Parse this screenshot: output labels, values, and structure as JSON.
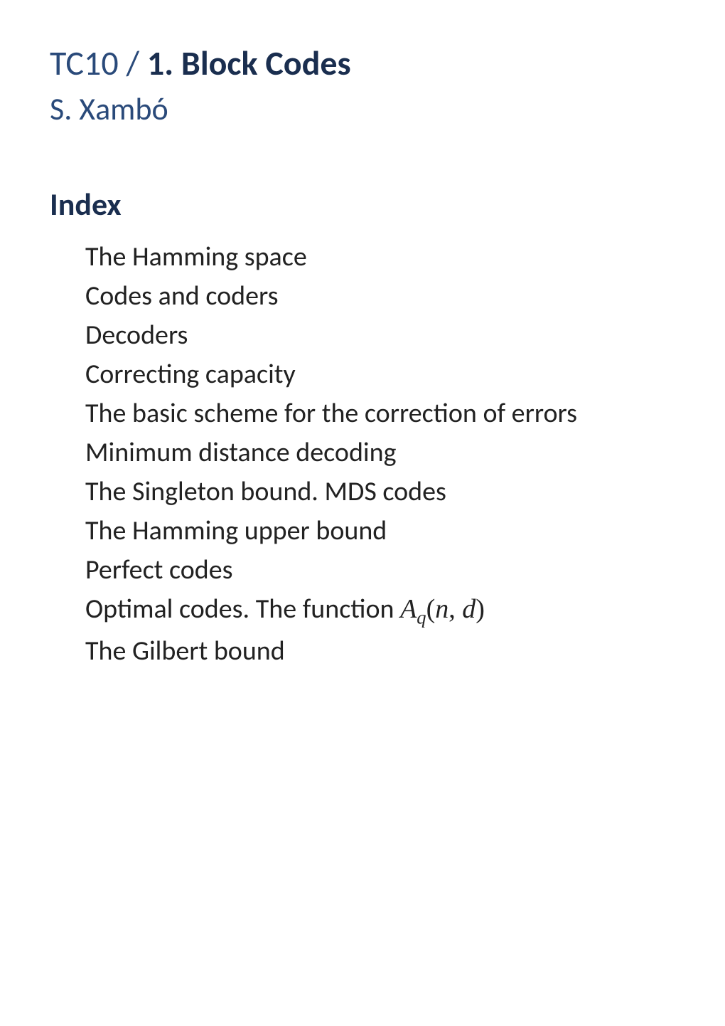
{
  "header": {
    "course_code": "TC10 / ",
    "topic": "1. Block Codes",
    "author": "S. Xambó"
  },
  "index": {
    "heading": "Index",
    "items": [
      "The Hamming space",
      "Codes and coders",
      "Decoders",
      "Correcting capacity",
      "The basic scheme for the correction of errors",
      "Minimum distance decoding",
      "The Singleton bound. MDS codes",
      "The Hamming upper bound",
      "Perfect codes",
      "Optimal codes. The function ",
      "The Gilbert bound"
    ],
    "math_function": {
      "A": "A",
      "q": "q",
      "open": "(",
      "n": "n",
      "comma": ", ",
      "d": "d",
      "close": ")"
    }
  }
}
